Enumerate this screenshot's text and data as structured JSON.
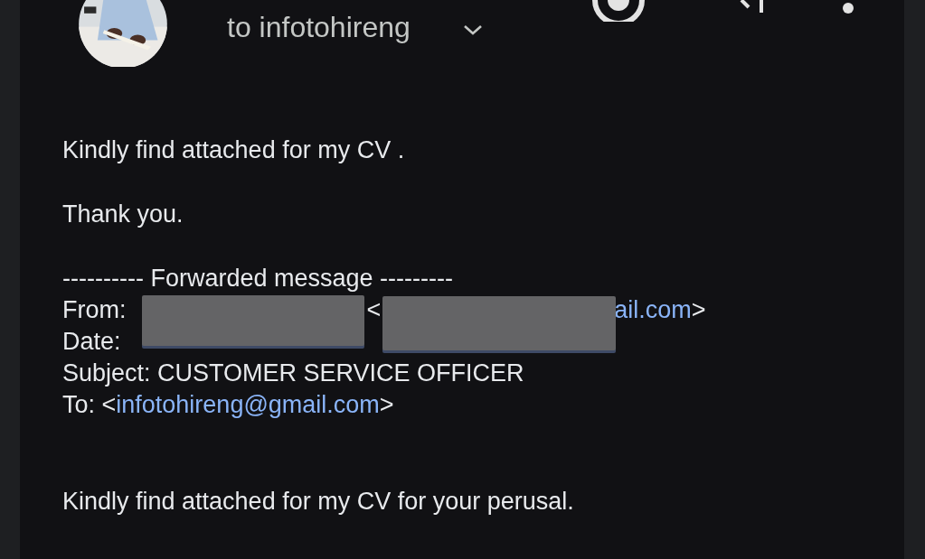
{
  "header": {
    "recipient": "to infotohireng"
  },
  "body": {
    "greeting": "Kindly find attached for my CV .",
    "thanks": "Thank you.",
    "forwarded": {
      "divider": "---------- Forwarded message ---------",
      "from": {
        "label": "From:",
        "bracket_open": "<",
        "email_visible": "ail.com",
        "bracket_close": ">"
      },
      "date": {
        "label": "Date:"
      },
      "subject": "Subject: CUSTOMER SERVICE OFFICER",
      "to": {
        "label": "To: <",
        "email": "infotohireng@gmail.com",
        "bracket_close": ">"
      }
    },
    "message": "Kindly find attached for my CV for your perusal."
  }
}
